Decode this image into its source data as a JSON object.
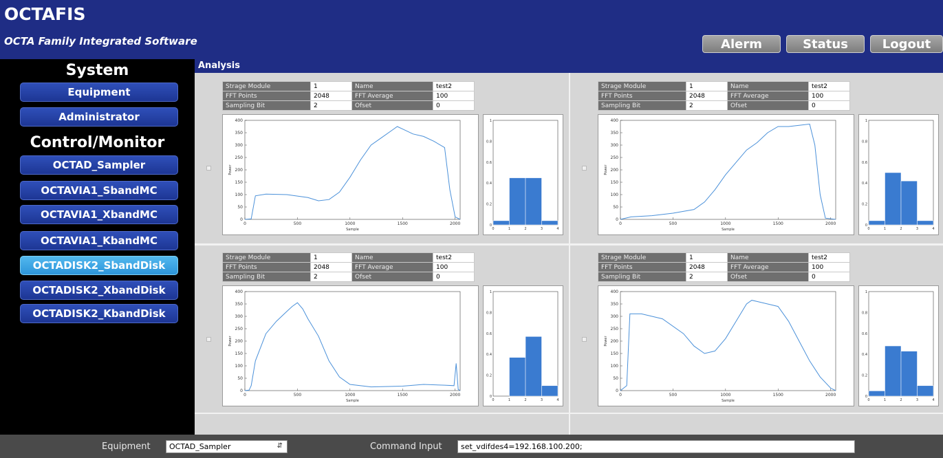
{
  "header": {
    "title": "OCTAFIS",
    "subtitle": "OCTA Family Integrated Software",
    "buttons": {
      "alarm": "Alerm",
      "status": "Status",
      "logout": "Logout"
    }
  },
  "sidebar": {
    "system_title": "System",
    "system_items": [
      "Equipment",
      "Administrator"
    ],
    "control_title": "Control/Monitor",
    "control_items": [
      "OCTAD_Sampler",
      "OCTAVIA1_SbandMC",
      "OCTAVIA1_XbandMC",
      "OCTAVIA1_KbandMC",
      "OCTADISK2_SbandDisk",
      "OCTADISK2_XbandDisk",
      "OCTADISK2_KbandDisk"
    ],
    "active_item": "OCTADISK2_SbandDisk"
  },
  "main": {
    "section_label": "Analysis",
    "panels": [
      {
        "info": {
          "strage_module_label": "Strage Module",
          "strage_module": "1",
          "name_label": "Name",
          "name": "test2",
          "fft_points_label": "FFT Points",
          "fft_points": "2048",
          "fft_average_label": "FFT Average",
          "fft_average": "100",
          "sampling_bit_label": "Sampling Bit",
          "sampling_bit": "2",
          "ofset_label": "Ofset",
          "ofset": "0"
        }
      },
      {
        "info": {
          "strage_module_label": "Strage Module",
          "strage_module": "1",
          "name_label": "Name",
          "name": "test2",
          "fft_points_label": "FFT Points",
          "fft_points": "2048",
          "fft_average_label": "FFT Average",
          "fft_average": "100",
          "sampling_bit_label": "Sampling Bit",
          "sampling_bit": "2",
          "ofset_label": "Ofset",
          "ofset": "0"
        }
      },
      {
        "info": {
          "strage_module_label": "Strage Module",
          "strage_module": "1",
          "name_label": "Name",
          "name": "test2",
          "fft_points_label": "FFT Points",
          "fft_points": "2048",
          "fft_average_label": "FFT Average",
          "fft_average": "100",
          "sampling_bit_label": "Sampling Bit",
          "sampling_bit": "2",
          "ofset_label": "Ofset",
          "ofset": "0"
        }
      },
      {
        "info": {
          "strage_module_label": "Strage Module",
          "strage_module": "1",
          "name_label": "Name",
          "name": "test2",
          "fft_points_label": "FFT Points",
          "fft_points": "2048",
          "fft_average_label": "FFT Average",
          "fft_average": "100",
          "sampling_bit_label": "Sampling Bit",
          "sampling_bit": "2",
          "ofset_label": "Ofset",
          "ofset": "0"
        }
      }
    ]
  },
  "footer": {
    "equipment_label": "Equipment",
    "equipment_value": "OCTAD_Sampler",
    "command_label": "Command Input",
    "command_value": "set_vdifdes4=192.168.100.200;"
  },
  "chart_data": [
    {
      "type": "line",
      "xlabel": "Sample",
      "ylabel": "Power",
      "xlim": [
        0,
        2048
      ],
      "ylim": [
        0,
        400
      ],
      "x_ticks": [
        "0",
        "500",
        "1000",
        "1500",
        "2000"
      ],
      "y_ticks": [
        "0",
        "50",
        "100",
        "150",
        "200",
        "250",
        "300",
        "350",
        "400"
      ],
      "series": [
        {
          "x": [
            0,
            60,
            100,
            200,
            400,
            600,
            700,
            800,
            900,
            1000,
            1100,
            1200,
            1300,
            1400,
            1450,
            1500,
            1600,
            1700,
            1800,
            1900,
            1950,
            2000,
            2048
          ],
          "values": [
            0,
            2,
            95,
            102,
            100,
            88,
            75,
            80,
            110,
            170,
            240,
            300,
            330,
            360,
            375,
            365,
            345,
            335,
            315,
            290,
            120,
            10,
            0
          ]
        }
      ]
    },
    {
      "type": "bar",
      "x_ticks": [
        "0",
        "1",
        "2",
        "3",
        "4"
      ],
      "y_ticks": [
        "0",
        "0.2",
        "0.4",
        "0.6",
        "0.8",
        "1"
      ],
      "ylim": [
        0,
        1
      ],
      "x": [
        0.5,
        1.5,
        2.5,
        3.5
      ],
      "values": [
        0.04,
        0.45,
        0.45,
        0.04
      ]
    },
    {
      "type": "line",
      "xlabel": "Sample",
      "ylabel": "Power",
      "xlim": [
        0,
        2048
      ],
      "ylim": [
        0,
        400
      ],
      "x_ticks": [
        "0",
        "500",
        "1000",
        "1500",
        "2000"
      ],
      "y_ticks": [
        "0",
        "50",
        "100",
        "150",
        "200",
        "250",
        "300",
        "350",
        "400"
      ],
      "series": [
        {
          "x": [
            0,
            100,
            300,
            500,
            700,
            800,
            900,
            1000,
            1100,
            1200,
            1300,
            1400,
            1500,
            1600,
            1700,
            1800,
            1850,
            1900,
            1950,
            2048
          ],
          "values": [
            0,
            10,
            15,
            25,
            40,
            70,
            120,
            180,
            230,
            280,
            310,
            350,
            375,
            375,
            380,
            385,
            300,
            100,
            5,
            0
          ]
        }
      ]
    },
    {
      "type": "bar",
      "x_ticks": [
        "0",
        "1",
        "2",
        "3",
        "4"
      ],
      "y_ticks": [
        "0",
        "0.2",
        "0.4",
        "0.6",
        "0.8",
        "1"
      ],
      "ylim": [
        0,
        1
      ],
      "x": [
        0.5,
        1.5,
        2.5,
        3.5
      ],
      "values": [
        0.04,
        0.5,
        0.42,
        0.04
      ]
    },
    {
      "type": "line",
      "xlabel": "Sample",
      "ylabel": "Power",
      "xlim": [
        0,
        2048
      ],
      "ylim": [
        0,
        400
      ],
      "x_ticks": [
        "0",
        "500",
        "1000",
        "1500",
        "2000"
      ],
      "y_ticks": [
        "0",
        "50",
        "100",
        "150",
        "200",
        "250",
        "300",
        "350",
        "400"
      ],
      "series": [
        {
          "x": [
            0,
            40,
            60,
            100,
            200,
            300,
            400,
            450,
            500,
            550,
            600,
            700,
            800,
            900,
            1000,
            1200,
            1500,
            1700,
            1900,
            1990,
            2010,
            2030,
            2048
          ],
          "values": [
            0,
            2,
            20,
            120,
            230,
            280,
            320,
            340,
            355,
            330,
            290,
            220,
            120,
            55,
            25,
            15,
            18,
            25,
            22,
            20,
            110,
            5,
            0
          ]
        }
      ]
    },
    {
      "type": "bar",
      "x_ticks": [
        "0",
        "1",
        "2",
        "3",
        "4"
      ],
      "y_ticks": [
        "0",
        "0.2",
        "0.4",
        "0.6",
        "0.8",
        "1"
      ],
      "ylim": [
        0,
        1
      ],
      "x": [
        0.5,
        1.5,
        2.5,
        3.5
      ],
      "values": [
        0,
        0.37,
        0.57,
        0.1
      ]
    },
    {
      "type": "line",
      "xlabel": "Sample",
      "ylabel": "Power",
      "xlim": [
        0,
        2048
      ],
      "ylim": [
        0,
        400
      ],
      "x_ticks": [
        "0",
        "500",
        "1000",
        "1500",
        "2000"
      ],
      "y_ticks": [
        "0",
        "50",
        "100",
        "150",
        "200",
        "250",
        "300",
        "350",
        "400"
      ],
      "series": [
        {
          "x": [
            0,
            60,
            90,
            200,
            400,
            600,
            700,
            800,
            900,
            1000,
            1100,
            1200,
            1250,
            1300,
            1400,
            1500,
            1600,
            1700,
            1800,
            1900,
            2000,
            2048
          ],
          "values": [
            0,
            20,
            310,
            310,
            290,
            230,
            180,
            150,
            160,
            210,
            280,
            350,
            365,
            360,
            350,
            340,
            280,
            200,
            120,
            55,
            10,
            0
          ]
        }
      ]
    },
    {
      "type": "bar",
      "x_ticks": [
        "0",
        "1",
        "2",
        "3",
        "4"
      ],
      "y_ticks": [
        "0",
        "0.2",
        "0.4",
        "0.6",
        "0.8",
        "1"
      ],
      "ylim": [
        0,
        1
      ],
      "x": [
        0.5,
        1.5,
        2.5,
        3.5
      ],
      "values": [
        0.05,
        0.48,
        0.43,
        0.1
      ]
    }
  ]
}
